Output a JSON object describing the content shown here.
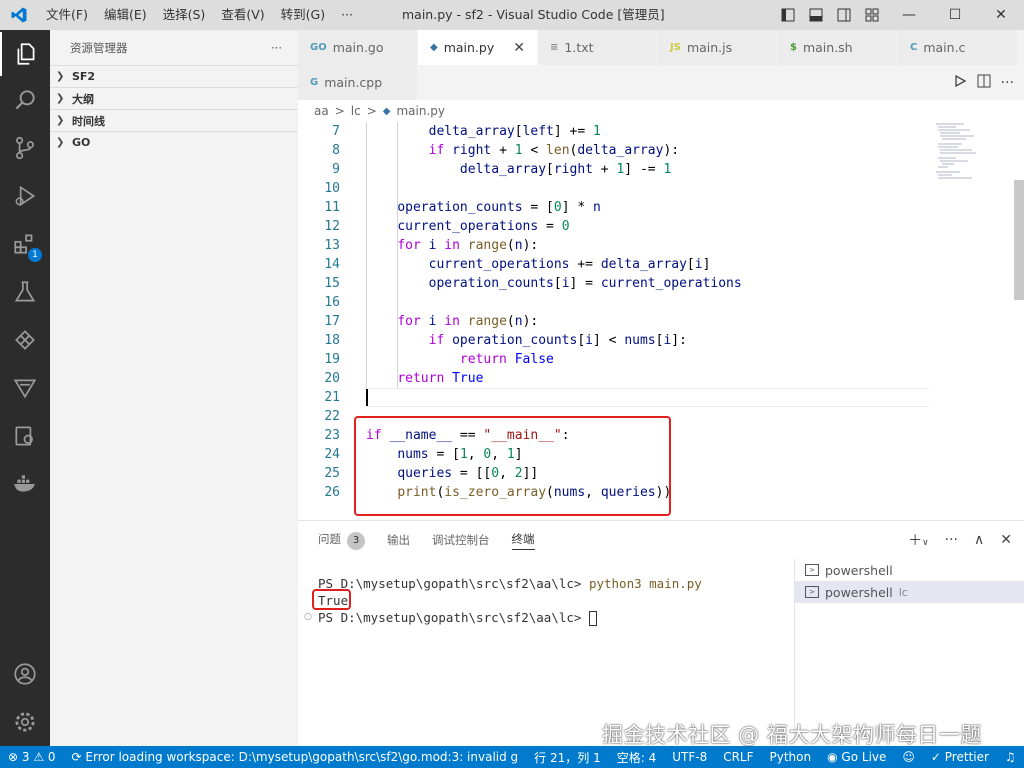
{
  "titlebar": {
    "menu": [
      "文件(F)",
      "编辑(E)",
      "选择(S)",
      "查看(V)",
      "转到(G)",
      "···"
    ],
    "window_title": "main.py - sf2 - Visual Studio Code [管理员]",
    "minimize": "—",
    "maximize": "☐",
    "close": "✕"
  },
  "activity": {
    "extensions_badge": "1"
  },
  "sidebar": {
    "title": "资源管理器",
    "more": "···",
    "sections": [
      "SF2",
      "大纲",
      "时间线",
      "GO"
    ]
  },
  "tabs": [
    {
      "icon": "GO",
      "label": "main.go",
      "color": "#519aba"
    },
    {
      "icon": "py",
      "label": "main.py",
      "color": "#3572A5",
      "active": true
    },
    {
      "icon": "≡",
      "label": "1.txt",
      "color": "#888888"
    },
    {
      "icon": "JS",
      "label": "main.js",
      "color": "#cbcb41"
    },
    {
      "icon": "$",
      "label": "main.sh",
      "color": "#4d9b3a"
    },
    {
      "icon": "C",
      "label": "main.c",
      "color": "#519aba"
    },
    {
      "icon": "G",
      "label": "main.cpp",
      "color": "#519aba"
    }
  ],
  "breadcrumb": [
    "aa",
    ">",
    "lc",
    ">",
    "main.py"
  ],
  "editor": {
    "lines": [
      {
        "n": "7",
        "t": "        delta_array[left] += 1"
      },
      {
        "n": "8",
        "t": "        if right + 1 < len(delta_array):"
      },
      {
        "n": "9",
        "t": "            delta_array[right + 1] -= 1"
      },
      {
        "n": "10",
        "t": ""
      },
      {
        "n": "11",
        "t": "    operation_counts = [0] * n"
      },
      {
        "n": "12",
        "t": "    current_operations = 0"
      },
      {
        "n": "13",
        "t": "    for i in range(n):"
      },
      {
        "n": "14",
        "t": "        current_operations += delta_array[i]"
      },
      {
        "n": "15",
        "t": "        operation_counts[i] = current_operations"
      },
      {
        "n": "16",
        "t": ""
      },
      {
        "n": "17",
        "t": "    for i in range(n):"
      },
      {
        "n": "18",
        "t": "        if operation_counts[i] < nums[i]:"
      },
      {
        "n": "19",
        "t": "            return False"
      },
      {
        "n": "20",
        "t": "    return True"
      },
      {
        "n": "21",
        "t": ""
      },
      {
        "n": "22",
        "t": ""
      },
      {
        "n": "23",
        "t": "if __name__ == \"__main__\":"
      },
      {
        "n": "24",
        "t": "    nums = [1, 0, 1]"
      },
      {
        "n": "25",
        "t": "    queries = [[0, 2]]"
      },
      {
        "n": "26",
        "t": "    print(is_zero_array(nums, queries))"
      }
    ]
  },
  "panel": {
    "tabs": [
      "问题",
      "输出",
      "调试控制台",
      "终端"
    ],
    "problems_count": "3",
    "terminal_lines": [
      {
        "prompt": "PS D:\\mysetup\\gopath\\src\\sf2\\aa\\lc> ",
        "cmd": "python3 main.py"
      },
      {
        "prompt": "True",
        "cmd": ""
      },
      {
        "prompt": "PS D:\\mysetup\\gopath\\src\\sf2\\aa\\lc> ",
        "cmd": ""
      }
    ],
    "terminals": [
      {
        "label": "powershell",
        "sub": ""
      },
      {
        "label": "powershell",
        "sub": "lc"
      }
    ]
  },
  "statusbar": {
    "errors": "⊗ 3 ⚠ 0",
    "message": "Error loading workspace: D:\\mysetup\\gopath\\src\\sf2\\go.mod:3: invalid g",
    "position": "行 21，列 1",
    "spaces": "空格: 4",
    "encoding": "UTF-8",
    "eol": "CRLF",
    "language": "Python",
    "golive": "Go Live",
    "prettier": "Prettier"
  },
  "watermark": "掘金技术社区 @ 福大大架构师每日一题"
}
